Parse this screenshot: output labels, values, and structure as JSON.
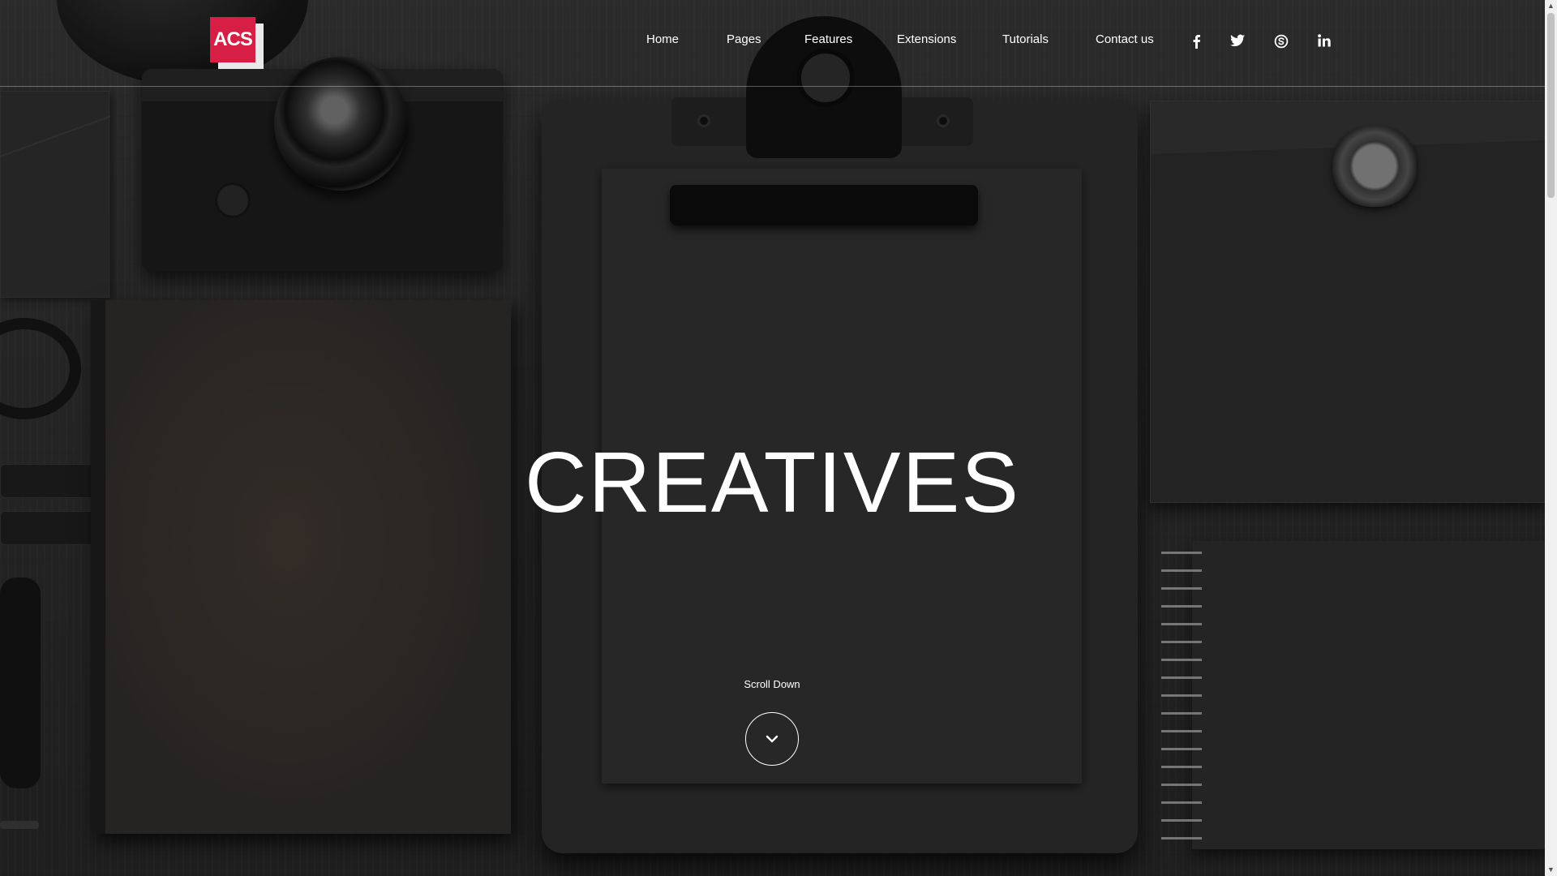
{
  "logo": {
    "text": "ACS"
  },
  "nav": {
    "items": [
      {
        "label": "Home"
      },
      {
        "label": "Pages"
      },
      {
        "label": "Features"
      },
      {
        "label": "Extensions"
      },
      {
        "label": "Tutorials"
      },
      {
        "label": "Contact us"
      }
    ],
    "social_icons": [
      "facebook-icon",
      "twitter-icon",
      "skype-icon",
      "linkedin-icon"
    ]
  },
  "hero": {
    "title": "CREATIVES",
    "scroll_label": "Scroll Down"
  },
  "colors": {
    "brand": "#d71f46",
    "text": "#ffffff",
    "background": "#2b2b2b"
  }
}
